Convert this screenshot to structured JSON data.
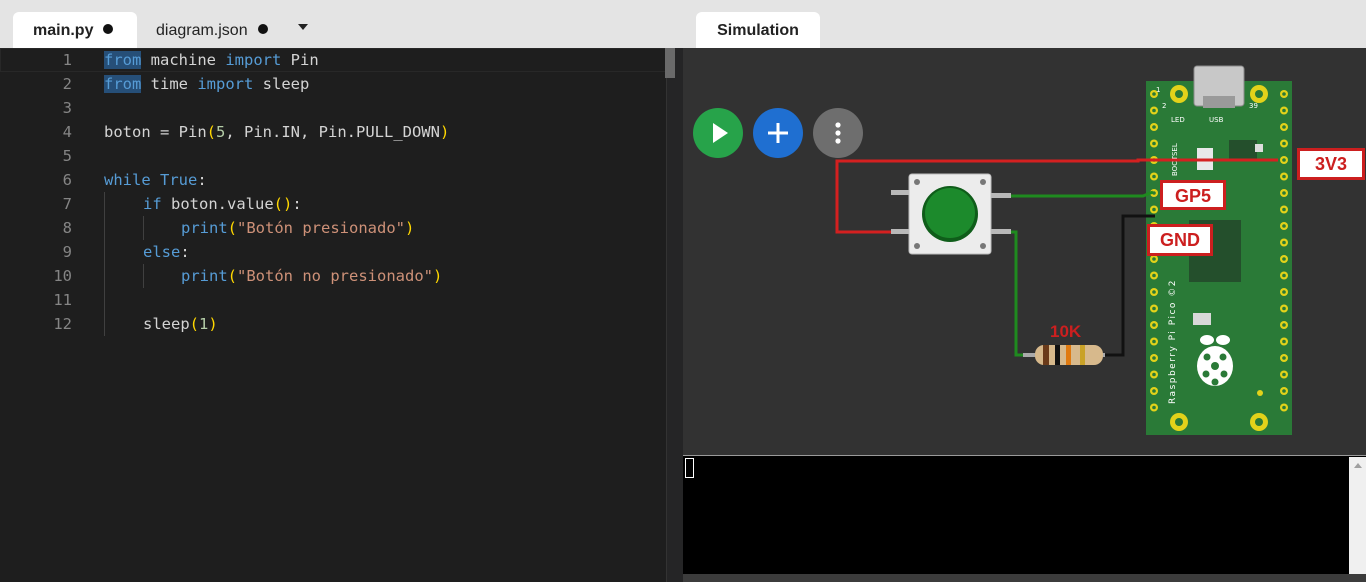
{
  "editor": {
    "tabs": [
      {
        "label": "main.py",
        "modified": true,
        "active": true
      },
      {
        "label": "diagram.json",
        "modified": true,
        "active": false
      }
    ],
    "lines": [
      {
        "num": "1"
      },
      {
        "num": "2"
      },
      {
        "num": "3"
      },
      {
        "num": "4"
      },
      {
        "num": "5"
      },
      {
        "num": "6"
      },
      {
        "num": "7"
      },
      {
        "num": "8"
      },
      {
        "num": "9"
      },
      {
        "num": "10"
      },
      {
        "num": "11"
      },
      {
        "num": "12"
      }
    ],
    "code": {
      "l1": [
        "from",
        " machine ",
        "import",
        " Pin"
      ],
      "l2": [
        "from",
        " time ",
        "import",
        " sleep"
      ],
      "l4": [
        "boton = Pin",
        "(",
        "5",
        ", Pin.IN, Pin.PULL_DOWN",
        ")"
      ],
      "l6": [
        "while",
        " ",
        "True",
        ":"
      ],
      "l7": [
        "if",
        " boton.value",
        "()",
        ":"
      ],
      "l8": [
        "print",
        "(",
        "\"Botón presionado\"",
        ")"
      ],
      "l9": [
        "else",
        ":"
      ],
      "l10": [
        "print",
        "(",
        "\"Botón no presionado\"",
        ")"
      ],
      "l12": [
        "sleep",
        "(",
        "1",
        ")"
      ]
    }
  },
  "simulation": {
    "tab_label": "Simulation",
    "toolbar": {
      "play_icon": "play-icon",
      "add_icon": "plus-icon",
      "menu_icon": "kebab-menu-icon"
    },
    "labels": {
      "v33": "3V3",
      "gp5": "GP5",
      "gnd": "GND",
      "resistor": "10K"
    },
    "board": {
      "silk_text": "Raspberry Pi Pico ©2",
      "led_text": "LED",
      "usb_text": "USB",
      "bootsel_text": "BOOTSEL",
      "pin_1": "1",
      "pin_2": "2",
      "pin_39": "39"
    },
    "colors": {
      "board": "#2a7a37",
      "wire_red": "#d42020",
      "wire_green": "#1f8a1f",
      "wire_black": "#111111",
      "button_cap": "#1c8a2c",
      "label_border": "#cc1f1f"
    }
  }
}
